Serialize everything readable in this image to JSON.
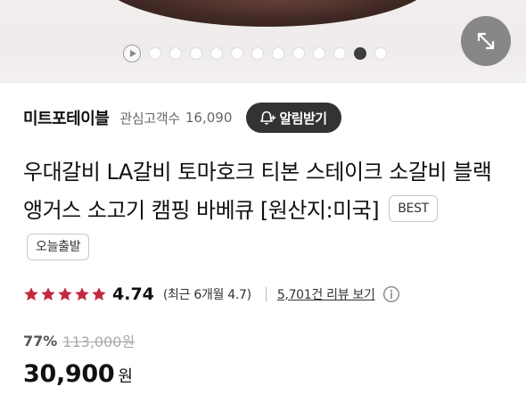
{
  "gallery": {
    "dot_count": 12,
    "active_index": 11,
    "play_icon": "play-circle-icon",
    "expand_icon": "expand-arrows-icon"
  },
  "store": {
    "name": "미트포테이블",
    "favorites_label": "관심고객수",
    "favorites_count": "16,090",
    "alarm_button": "알림받기",
    "alarm_icon": "bell-plus-icon"
  },
  "product": {
    "title": "우대갈비 LA갈비 토마호크 티본 스테이크 소갈비 블랙앵거스 소고기 캠핑 바베큐 [원산지:미국]",
    "badges": [
      "BEST",
      "오늘출발"
    ]
  },
  "rating": {
    "stars": 5,
    "star_color": "#c2293f",
    "score": "4.74",
    "recent": "(최근 6개월 4.7)",
    "review_link": "5,701건 리뷰 보기",
    "info_icon": "info-circle-icon"
  },
  "price": {
    "discount": "77%",
    "original": "113,000원",
    "sale": "30,900",
    "currency": "원"
  }
}
